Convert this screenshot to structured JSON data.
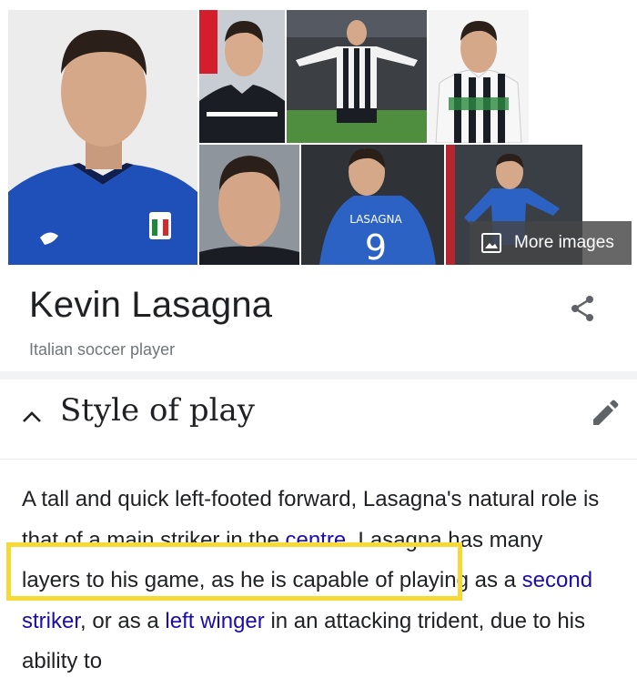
{
  "images": {
    "more_images_label": "More images"
  },
  "entity": {
    "name": "Kevin Lasagna",
    "subtitle": "Italian soccer player"
  },
  "section": {
    "title": "Style of play",
    "paragraph": {
      "t1": "A tall and quick left-footed forward, Lasagna's natural role is that of a main striker in the ",
      "link1": "centre",
      "t2": ". ",
      "t3": "Lasagna has many layers to his game,",
      "t4": " as he is capable of playing as a ",
      "link2": "second striker",
      "t5": ", or as a ",
      "link3": "left winger",
      "t6": " in an attacking trident, due to his ability to"
    }
  },
  "colors": {
    "link": "#1a0dab",
    "highlight": "#f6d935",
    "italy_blue": "#1f4fb8"
  }
}
